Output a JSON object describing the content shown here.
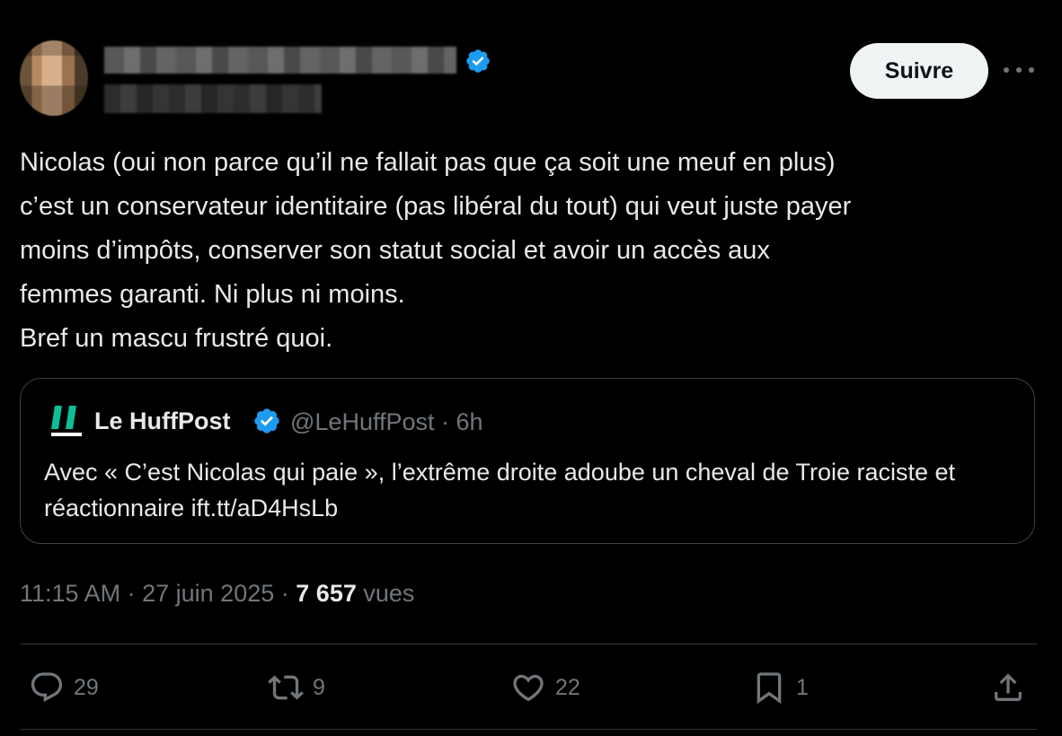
{
  "tweet": {
    "follow_label": "Suivre",
    "text": "Nicolas (oui non parce qu’il ne fallait pas que ça soit une meuf en plus)\nc’est un conservateur identitaire (pas libéral du tout) qui veut juste payer\nmoins d’impôts, conserver son statut social et avoir un accès aux\nfemmes garanti. Ni plus ni moins.\nBref un mascu frustré quoi."
  },
  "quote": {
    "name": "Le HuffPost",
    "handle": "@LeHuffPost",
    "separator": "·",
    "time": "6h",
    "text": "Avec « C’est Nicolas qui paie », l’extrême droite adoube un cheval de Troie raciste et réactionnaire   ift.tt/aD4HsLb",
    "logo_text": "LE HUFFPOST"
  },
  "meta": {
    "time": "11:15 AM",
    "date": "27 juin 2025",
    "separator": "·",
    "views_count": "7 657",
    "views_label": "vues"
  },
  "actions": {
    "replies": "29",
    "retweets": "9",
    "likes": "22",
    "bookmarks": "1"
  },
  "colors": {
    "background": "#000000",
    "text": "#e7e9ea",
    "muted": "#71767b",
    "verified": "#1d9bf0",
    "huffpost_green": "#0dbe98"
  },
  "icons": [
    "verified-badge-icon",
    "more-icon",
    "huffpost-logo-icon",
    "reply-icon",
    "retweet-icon",
    "like-icon",
    "bookmark-icon",
    "share-icon"
  ]
}
